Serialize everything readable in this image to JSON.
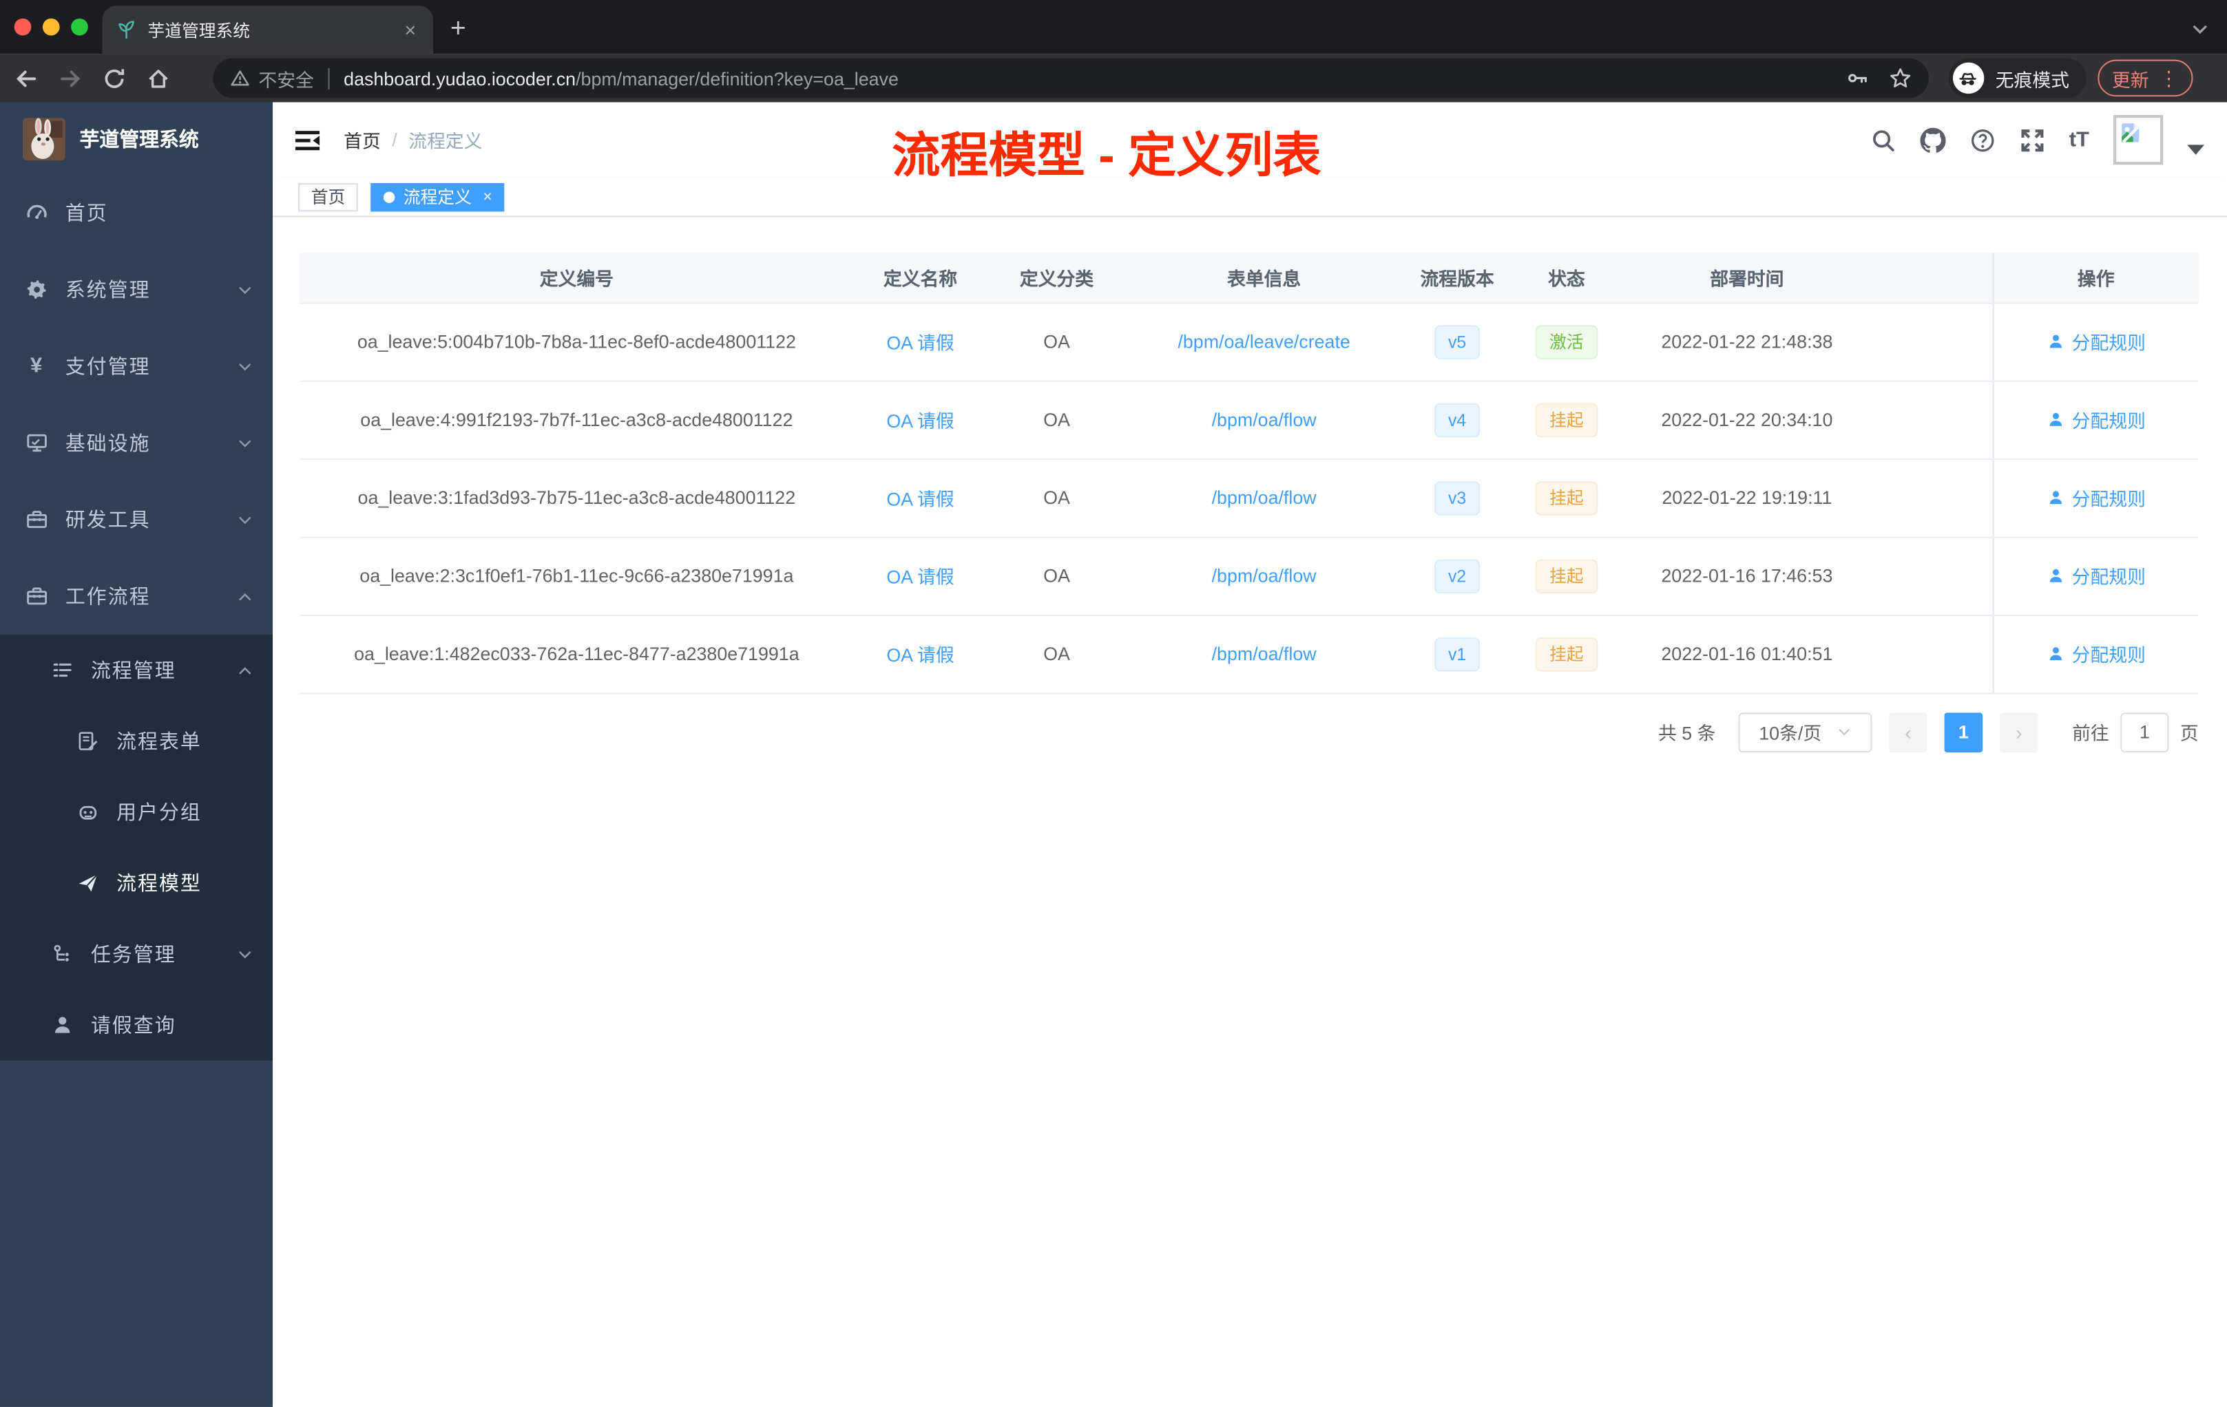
{
  "colors": {
    "accent": "#409eff",
    "annotation_red": "#ff2a00",
    "sidebar_bg": "#304156",
    "submenu_bg": "#1f2d3d",
    "status_active_green": "#67c23a",
    "status_suspended_orange": "#e6a23c",
    "version_blue": "#409eff",
    "tag_active_blue": "#409eff"
  },
  "browser": {
    "tab_title": "芋道管理系统",
    "close_glyph": "×",
    "newtab_glyph": "+",
    "security_label": "不安全",
    "url_host": "dashboard.yudao.iocoder.cn",
    "url_path": "/bpm/manager/definition?key=oa_leave",
    "incognito_label": "无痕模式",
    "update_label": "更新",
    "kebab_glyph": "⋮"
  },
  "sidebar": {
    "app_title": "芋道管理系统",
    "items": [
      {
        "label": "首页",
        "icon": "dashboard",
        "level": 0,
        "submenu": false,
        "expand": null,
        "active": false
      },
      {
        "label": "系统管理",
        "icon": "gear",
        "level": 0,
        "submenu": false,
        "expand": "down",
        "active": false
      },
      {
        "label": "支付管理",
        "icon": "yen",
        "level": 0,
        "submenu": false,
        "expand": "down",
        "active": false
      },
      {
        "label": "基础设施",
        "icon": "monitor",
        "level": 0,
        "submenu": false,
        "expand": "down",
        "active": false
      },
      {
        "label": "研发工具",
        "icon": "toolbox",
        "level": 0,
        "submenu": false,
        "expand": "down",
        "active": false
      },
      {
        "label": "工作流程",
        "icon": "toolbox",
        "level": 0,
        "submenu": false,
        "expand": "up",
        "active": false
      },
      {
        "label": "流程管理",
        "icon": "list",
        "level": 1,
        "submenu": true,
        "expand": "up",
        "active": false
      },
      {
        "label": "流程表单",
        "icon": "form",
        "level": 2,
        "submenu": true,
        "expand": null,
        "active": false
      },
      {
        "label": "用户分组",
        "icon": "robot",
        "level": 2,
        "submenu": true,
        "expand": null,
        "active": false
      },
      {
        "label": "流程模型",
        "icon": "paper-plane",
        "level": 2,
        "submenu": true,
        "expand": null,
        "active": true
      },
      {
        "label": "任务管理",
        "icon": "tree",
        "level": 1,
        "submenu": true,
        "expand": "down",
        "active": false
      },
      {
        "label": "请假查询",
        "icon": "user",
        "level": 1,
        "submenu": true,
        "expand": null,
        "active": false
      }
    ]
  },
  "navbar": {
    "breadcrumb": {
      "home": "首页",
      "separator": "/",
      "current": "流程定义"
    },
    "annotation": "流程模型 - 定义列表",
    "icons": [
      "search",
      "github",
      "help",
      "fullscreen",
      "fontsize"
    ],
    "fontsize_glyph": "tT"
  },
  "tags": [
    {
      "label": "首页",
      "active": false,
      "closable": false
    },
    {
      "label": "流程定义",
      "active": true,
      "closable": true,
      "close_glyph": "×"
    }
  ],
  "table": {
    "columns": [
      {
        "label": "定义编号"
      },
      {
        "label": "定义名称"
      },
      {
        "label": "定义分类"
      },
      {
        "label": "表单信息"
      },
      {
        "label": "流程版本"
      },
      {
        "label": "状态"
      },
      {
        "label": "部署时间"
      },
      {
        "label": ""
      },
      {
        "label": "操作"
      }
    ],
    "rows": [
      {
        "id": "oa_leave:5:004b710b-7b8a-11ec-8ef0-acde48001122",
        "name": "OA 请假",
        "category": "OA",
        "form": "/bpm/oa/leave/create",
        "version": "v5",
        "status": "激活",
        "status_type": "active",
        "deployed": "2022-01-22 21:48:38",
        "action": "分配规则"
      },
      {
        "id": "oa_leave:4:991f2193-7b7f-11ec-a3c8-acde48001122",
        "name": "OA 请假",
        "category": "OA",
        "form": "/bpm/oa/flow",
        "version": "v4",
        "status": "挂起",
        "status_type": "suspended",
        "deployed": "2022-01-22 20:34:10",
        "action": "分配规则"
      },
      {
        "id": "oa_leave:3:1fad3d93-7b75-11ec-a3c8-acde48001122",
        "name": "OA 请假",
        "category": "OA",
        "form": "/bpm/oa/flow",
        "version": "v3",
        "status": "挂起",
        "status_type": "suspended",
        "deployed": "2022-01-22 19:19:11",
        "action": "分配规则"
      },
      {
        "id": "oa_leave:2:3c1f0ef1-76b1-11ec-9c66-a2380e71991a",
        "name": "OA 请假",
        "category": "OA",
        "form": "/bpm/oa/flow",
        "version": "v2",
        "status": "挂起",
        "status_type": "suspended",
        "deployed": "2022-01-16 17:46:53",
        "action": "分配规则"
      },
      {
        "id": "oa_leave:1:482ec033-762a-11ec-8477-a2380e71991a",
        "name": "OA 请假",
        "category": "OA",
        "form": "/bpm/oa/flow",
        "version": "v1",
        "status": "挂起",
        "status_type": "suspended",
        "deployed": "2022-01-16 01:40:51",
        "action": "分配规则"
      }
    ]
  },
  "pagination": {
    "total_text": "共 5 条",
    "page_size": "10条/页",
    "prev_glyph": "‹",
    "current_page": "1",
    "next_glyph": "›",
    "goto_label": "前往",
    "goto_value": "1",
    "page_unit": "页"
  }
}
